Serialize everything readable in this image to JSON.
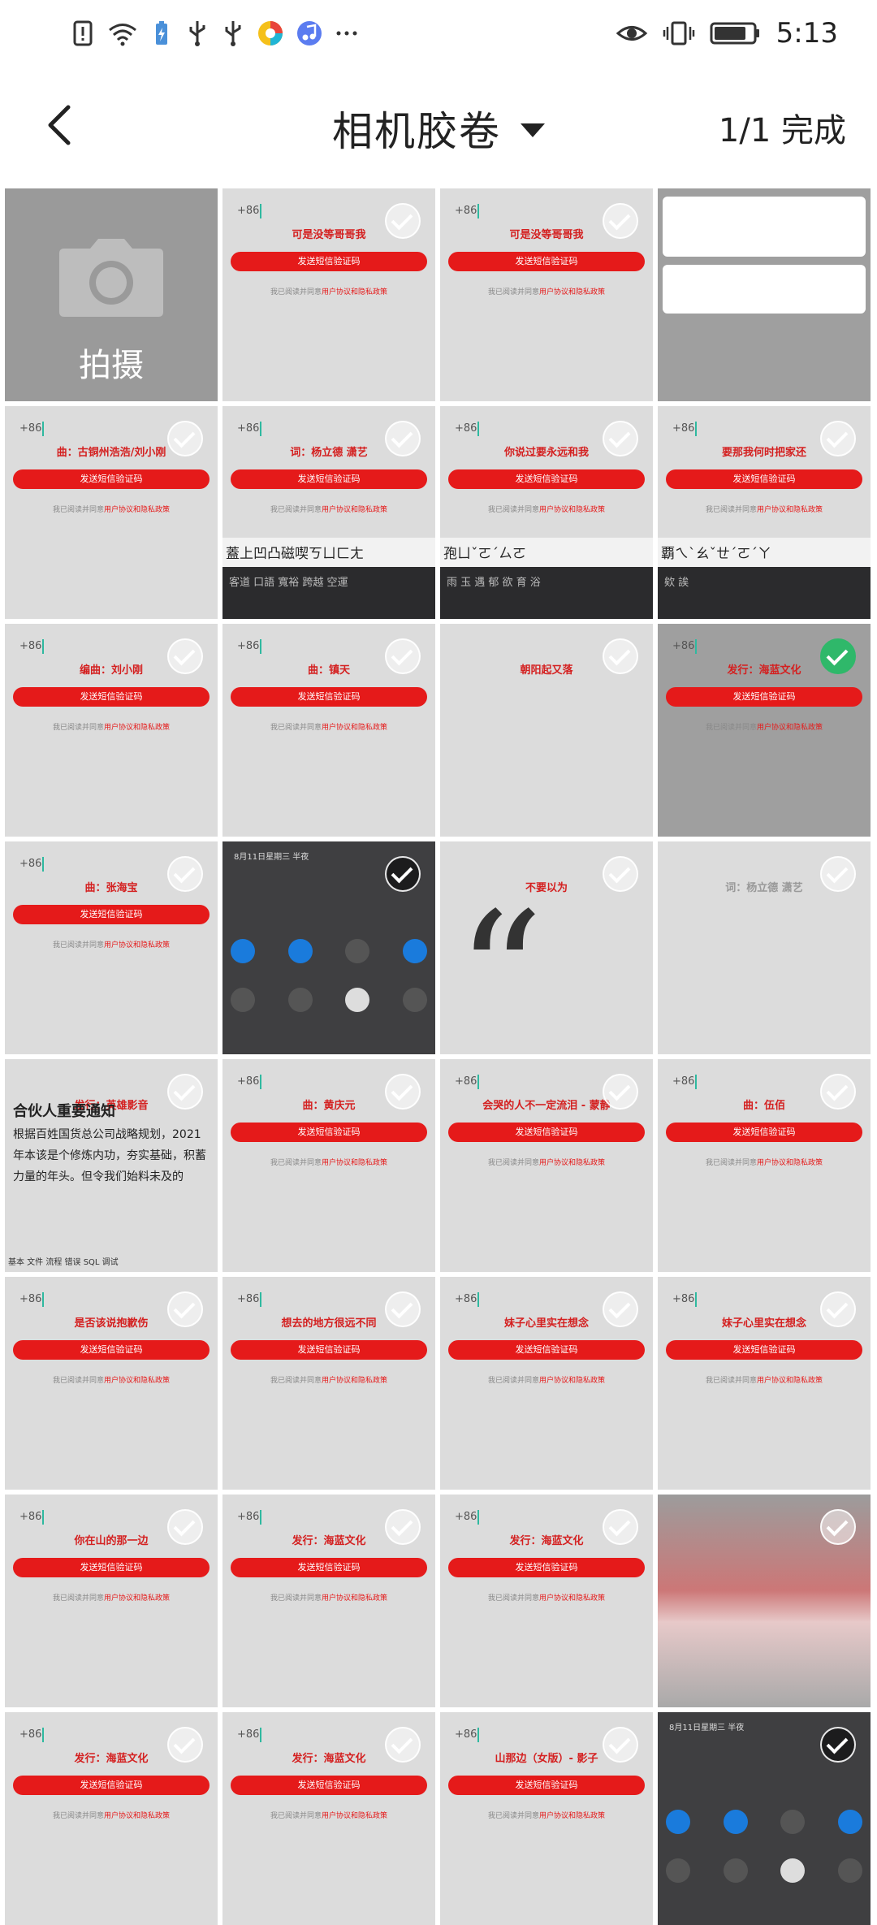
{
  "status_bar": {
    "time": "5:13",
    "left_icons": [
      "alert-icon",
      "wifi-icon",
      "battery-saver-icon",
      "usb-icon",
      "usb-icon",
      "app-icon",
      "music-icon",
      "more-icon"
    ],
    "right_icons": [
      "eye-icon",
      "vibrate-icon",
      "battery-icon"
    ]
  },
  "header": {
    "title": "相机胶卷",
    "selection_status": "1/1 完成"
  },
  "camera_tile": {
    "label": "拍摄"
  },
  "common": {
    "code_prefix": "+86",
    "send_code": "发送短信验证码",
    "agree_text": "我已阅读并同意",
    "agree_link": "用户协议和隐私政策"
  },
  "thumbnails": [
    {
      "kind": "login",
      "line1": "可是没等哥哥我",
      "line2": "",
      "selected": true
    },
    {
      "kind": "login",
      "line1": "可是没等哥哥我",
      "line2": "",
      "selected": true
    },
    {
      "kind": "notification",
      "selected": true
    },
    {
      "kind": "login",
      "line1": "曲：古铜州浩浩/刘小刚",
      "line2": "",
      "selected": true
    },
    {
      "kind": "login-keyboard",
      "line1": "词：杨立德 潇艺",
      "kb_text": "蓋上凹凸磁喫ㄎㄩㄈㄤ",
      "kb_row": "客道 口語 寬裕 跨越 空運",
      "selected": true
    },
    {
      "kind": "login-keyboard",
      "line1": "你说过要永远和我",
      "kb_text": "孢ㄩˇㄛˊㄙㄛ",
      "kb_row": "雨 玉 遇 郁 欲 育 浴",
      "selected": true
    },
    {
      "kind": "login-keyboard",
      "line1": "要那我何时把家还",
      "kb_text": "覇ㄟˋㄠˇㄝˊㄛˊㄚ",
      "kb_row": "欸 誒",
      "selected": true
    },
    {
      "kind": "login",
      "line1": "编曲：刘小刚",
      "line2": "",
      "selected": true
    },
    {
      "kind": "login",
      "line1": "曲：镇天",
      "line2": "",
      "selected": true
    },
    {
      "kind": "news-app",
      "line1": "朝阳起又落",
      "selected": true
    },
    {
      "kind": "login-gray",
      "line1": "发行：海蓝文化",
      "selected": true,
      "green": true
    },
    {
      "kind": "login",
      "line1": "曲：张海宝",
      "line2": "",
      "selected": true
    },
    {
      "kind": "quick-settings",
      "date": "8月11日星期三 半夜",
      "selected": true
    },
    {
      "kind": "quote",
      "line1": "不要以为",
      "selected": true
    },
    {
      "kind": "blank",
      "line1": "词：杨立德 潇艺",
      "selected": true
    },
    {
      "kind": "article",
      "line1": "发行：英雄影音",
      "title": "合伙人重要通知",
      "body": "根据百姓国货总公司战略规划，2021年本该是个修炼内功，夯实基础，积蓄力量的年头。但令我们始料未及的",
      "tabs": "基本  文件  流程  错误  SQL  调试",
      "selected": true
    },
    {
      "kind": "login",
      "line1": "曲：黄庆元",
      "line2": "",
      "selected": true
    },
    {
      "kind": "login",
      "line1": "会哭的人不一定流泪 - 蒙静",
      "line2": "",
      "selected": true
    },
    {
      "kind": "login",
      "line1": "曲：伍佰",
      "line2": "",
      "selected": true
    },
    {
      "kind": "login",
      "line1": "是否该说抱歉伤",
      "line2": "",
      "selected": true
    },
    {
      "kind": "login",
      "line1": "想去的地方很远不同",
      "line2": "",
      "selected": true
    },
    {
      "kind": "login",
      "line1": "妹子心里实在想念",
      "line2": "",
      "selected": true
    },
    {
      "kind": "login",
      "line1": "妹子心里实在想念",
      "line2": "",
      "selected": true
    },
    {
      "kind": "login",
      "line1": "你在山的那一边",
      "line2": "",
      "selected": true
    },
    {
      "kind": "login",
      "line1": "发行：海蓝文化",
      "line2": "",
      "selected": true
    },
    {
      "kind": "login",
      "line1": "发行：海蓝文化",
      "line2": "",
      "selected": true
    },
    {
      "kind": "blur",
      "selected": true
    },
    {
      "kind": "login",
      "line1": "发行：海蓝文化",
      "line2": "",
      "selected": true
    },
    {
      "kind": "login",
      "line1": "发行：海蓝文化",
      "line2": "",
      "selected": true
    },
    {
      "kind": "login",
      "line1": "山那边（女版）- 影子",
      "line2": "",
      "selected": true
    },
    {
      "kind": "quick-settings",
      "date": "8月11日星期三 半夜",
      "selected": true
    }
  ]
}
